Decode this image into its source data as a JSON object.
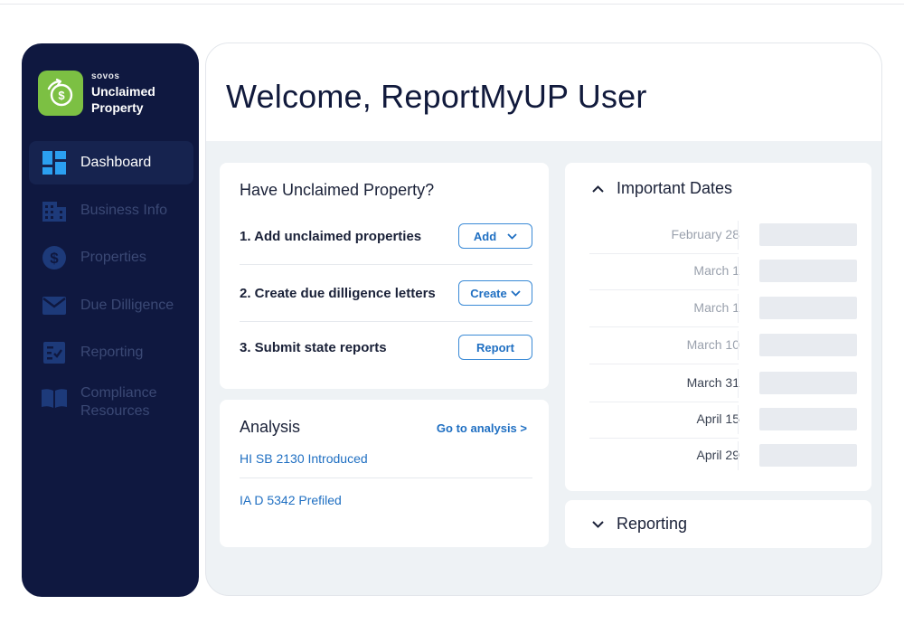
{
  "brand": {
    "company": "sovos",
    "product": "Unclaimed Property",
    "logo_color": "#7cc043"
  },
  "sidebar": {
    "background": "#0f1840",
    "items": [
      {
        "label": "Dashboard",
        "icon": "dashboard-icon",
        "active": true
      },
      {
        "label": "Business Info",
        "icon": "building-icon",
        "active": false
      },
      {
        "label": "Properties",
        "icon": "dollar-icon",
        "active": false
      },
      {
        "label": "Due Dilligence",
        "icon": "envelope-icon",
        "active": false
      },
      {
        "label": "Reporting",
        "icon": "report-icon",
        "active": false
      },
      {
        "label": "Compliance Resources",
        "icon": "book-icon",
        "active": false
      }
    ]
  },
  "header": {
    "welcome": "Welcome, ReportMyUP User"
  },
  "unclaimed": {
    "title": "Have Unclaimed Property?",
    "steps": [
      {
        "label": "1.  Add unclaimed properties",
        "button": "Add",
        "has_dropdown": true
      },
      {
        "label": "2.  Create due dilligence letters",
        "button": "Create",
        "has_dropdown": true
      },
      {
        "label": "3.  Submit state reports",
        "button": "Report",
        "has_dropdown": false
      }
    ]
  },
  "analysis": {
    "title": "Analysis",
    "go_link": "Go to analysis >",
    "links": [
      "HI SB 2130 Introduced",
      "IA D 5342 Prefiled"
    ]
  },
  "important_dates": {
    "title": "Important Dates",
    "dates": [
      {
        "date": "February 28",
        "emphasis": false
      },
      {
        "date": "March 1",
        "emphasis": false
      },
      {
        "date": "March 1",
        "emphasis": false
      },
      {
        "date": "March 10",
        "emphasis": false
      },
      {
        "date": "March 31",
        "emphasis": true
      },
      {
        "date": "April 15",
        "emphasis": true
      },
      {
        "date": "April 29",
        "emphasis": true
      }
    ]
  },
  "reporting_section": {
    "title": "Reporting"
  },
  "colors": {
    "accent": "#1f6fc2",
    "active_nav_bg": "#16234f",
    "inactive_nav_text": "#3b4975"
  }
}
